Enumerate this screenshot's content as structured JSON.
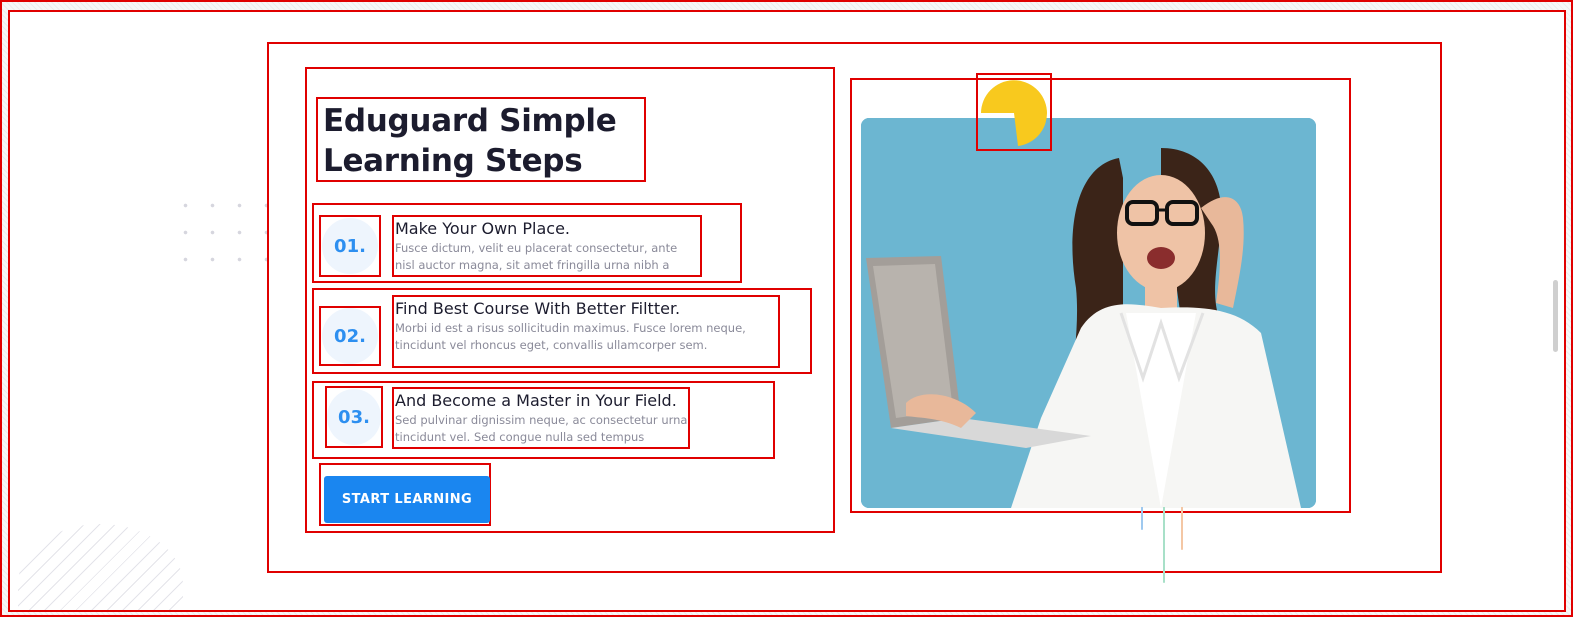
{
  "heading": {
    "line1": "Eduguard Simple",
    "line2": "Learning Steps"
  },
  "steps": [
    {
      "number": "01.",
      "title": "Make Your Own Place.",
      "description": "Fusce dictum, velit eu placerat consectetur, ante nisl auctor magna, sit amet fringilla urna nibh a risus."
    },
    {
      "number": "02.",
      "title": "Find Best Course With Better Filtter.",
      "description": "Morbi id est a risus sollicitudin maximus. Fusce lorem neque, tincidunt vel rhoncus eget, convallis ullamcorper sem."
    },
    {
      "number": "03.",
      "title": "And Become a Master in Your Field.",
      "description": "Sed pulvinar dignissim neque, ac consectetur urna tincidunt vel. Sed congue nulla sed tempus ultrices."
    }
  ],
  "cta": {
    "label": "START LEARNING"
  },
  "colors": {
    "accent_blue": "#1a86f0",
    "number_blue": "#2d8ff0",
    "badge_bg": "#eef5fd",
    "heading_dark": "#1c1c2e",
    "muted_text": "#8a8a99",
    "image_bg": "#6cb6d1",
    "decor_yellow": "#f8c91e",
    "annotation_red": "#e00000"
  },
  "icons": {
    "decor_shape": "yellow-pie-icon",
    "hero": "student-with-laptop-photo"
  }
}
